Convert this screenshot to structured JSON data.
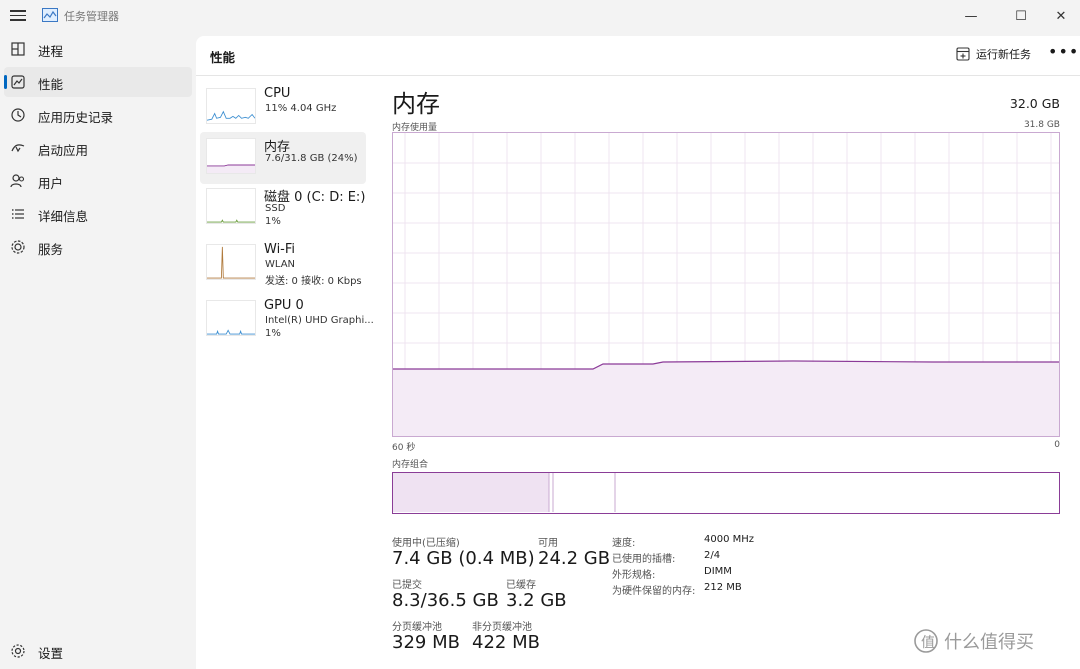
{
  "window": {
    "title": "任务管理器",
    "minimize_glyph": "—",
    "maximize_glyph": "☐",
    "close_glyph": "✕"
  },
  "sidebar": {
    "items": [
      {
        "label": "进程",
        "icon": "processes-icon"
      },
      {
        "label": "性能",
        "icon": "performance-icon",
        "active": true
      },
      {
        "label": "应用历史记录",
        "icon": "history-icon"
      },
      {
        "label": "启动应用",
        "icon": "startup-icon"
      },
      {
        "label": "用户",
        "icon": "users-icon"
      },
      {
        "label": "详细信息",
        "icon": "details-icon"
      },
      {
        "label": "服务",
        "icon": "services-icon"
      }
    ],
    "settings_label": "设置"
  },
  "header": {
    "title": "性能",
    "run_task_label": "运行新任务",
    "more_glyph": "•••"
  },
  "devices": [
    {
      "name": "CPU",
      "lines": [
        "11%  4.04 GHz"
      ]
    },
    {
      "name": "内存",
      "lines": [
        "7.6/31.8 GB (24%)"
      ],
      "active": true
    },
    {
      "name": "磁盘 0 (C: D: E:)",
      "lines": [
        "SSD",
        "1%"
      ]
    },
    {
      "name": "Wi-Fi",
      "lines": [
        "WLAN",
        "发送: 0  接收: 0 Kbps"
      ]
    },
    {
      "name": "GPU 0",
      "lines": [
        "Intel(R) UHD Graphi...",
        "1%"
      ]
    }
  ],
  "memory": {
    "title": "内存",
    "total": "32.0 GB",
    "usage_label": "内存使用量",
    "usage_max": "31.8 GB",
    "time_left": "60 秒",
    "time_right": "0",
    "composition_label": "内存组合",
    "stats": {
      "in_use_label": "使用中(已压缩)",
      "in_use_value": "7.4 GB (0.4 MB)",
      "available_label": "可用",
      "available_value": "24.2 GB",
      "committed_label": "已提交",
      "committed_value": "8.3/36.5 GB",
      "cached_label": "已缓存",
      "cached_value": "3.2 GB",
      "paged_label": "分页缓冲池",
      "paged_value": "329 MB",
      "nonpaged_label": "非分页缓冲池",
      "nonpaged_value": "422 MB"
    },
    "specs": [
      {
        "key": "速度:",
        "value": "4000 MHz"
      },
      {
        "key": "已使用的插槽:",
        "value": "2/4"
      },
      {
        "key": "外形规格:",
        "value": "DIMM"
      },
      {
        "key": "为硬件保留的内存:",
        "value": "212 MB"
      }
    ]
  },
  "watermark": "什么值得买",
  "colors": {
    "accent": "#0067c0",
    "memory_line": "#8b3a98",
    "memory_fill": "#f4ebf6"
  }
}
